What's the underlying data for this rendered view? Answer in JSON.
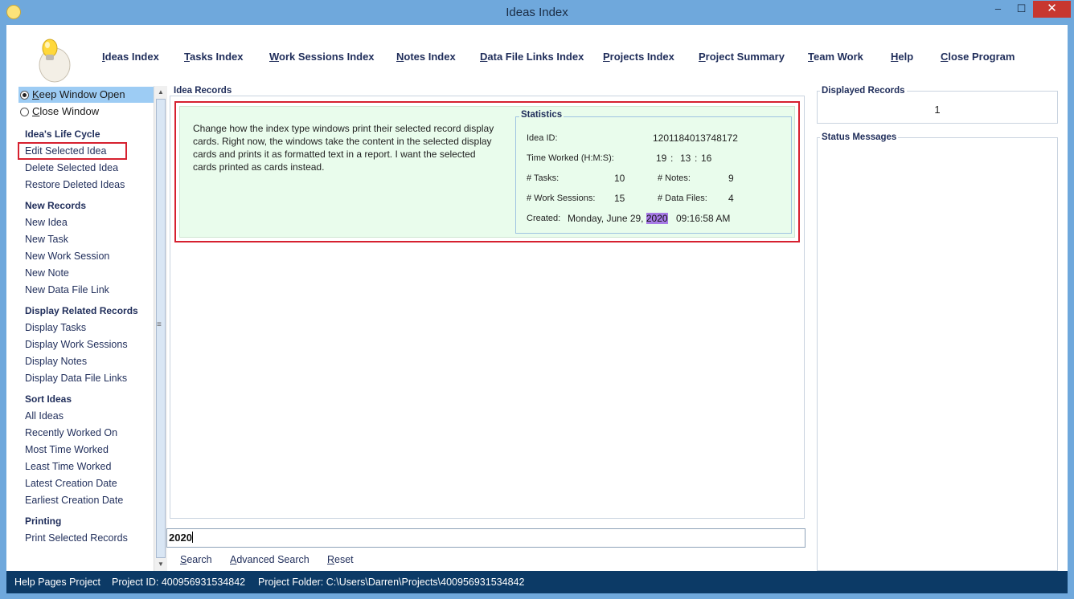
{
  "window": {
    "title": "Ideas Index",
    "min_glyph": "–",
    "max_glyph": "☐",
    "close_glyph": "✕"
  },
  "topnav": {
    "items": [
      {
        "key": "I",
        "rest": "deas Index"
      },
      {
        "key": "T",
        "rest": "asks Index"
      },
      {
        "key": "W",
        "rest": "ork Sessions Index"
      },
      {
        "key": "N",
        "rest": "otes Index"
      },
      {
        "key": "D",
        "rest": "ata File Links Index"
      },
      {
        "key": "P",
        "rest": "rojects Index"
      },
      {
        "key": "P",
        "rest": "roject Summary"
      },
      {
        "key": "T",
        "rest": "eam Work"
      },
      {
        "key": "H",
        "rest": "elp"
      },
      {
        "key": "C",
        "rest": "lose Program"
      }
    ]
  },
  "sidebar": {
    "keep_open_key": "K",
    "keep_open_rest": "eep Window Open",
    "close_window_key": "C",
    "close_window_rest": "lose Window",
    "life_cycle_heading": "Idea's Life Cycle",
    "life_cycle": [
      "Edit Selected Idea",
      "Delete Selected Idea",
      "Restore Deleted Ideas"
    ],
    "new_records_heading": "New Records",
    "new_records": [
      "New Idea",
      "New Task",
      "New Work Session",
      "New Note",
      "New Data File Link"
    ],
    "display_heading": "Display Related Records",
    "display": [
      "Display Tasks",
      "Display Work Sessions",
      "Display Notes",
      "Display Data File Links"
    ],
    "sort_heading": "Sort Ideas",
    "sort": [
      "All Ideas",
      "Recently Worked On",
      "Most Time Worked",
      "Least Time Worked",
      "Latest Creation Date",
      "Earliest Creation Date"
    ],
    "printing_heading": "Printing",
    "printing": [
      "Print Selected Records"
    ]
  },
  "records": {
    "group_title": "Idea Records",
    "card_text": "Change how the index type windows print their selected record display cards. Right now, the windows take the content in the selected display cards and prints it as formatted text in a report. I want the selected cards printed as cards instead.",
    "stats": {
      "title": "Statistics",
      "idea_id_label": "Idea ID:",
      "idea_id": "1201184013748172",
      "time_label": "Time Worked (H:M:S):",
      "hours": "19",
      "minutes": "13",
      "seconds": "16",
      "sep": ":",
      "tasks_label": "# Tasks:",
      "tasks": "10",
      "notes_label": "# Notes:",
      "notes": "9",
      "sessions_label": "# Work Sessions:",
      "sessions": "15",
      "files_label": "# Data Files:",
      "files": "4",
      "created_label": "Created:",
      "created_date_prefix": "Monday, June 29,",
      "created_year": "2020",
      "created_time": "09:16:58 AM"
    }
  },
  "search": {
    "value": "2020",
    "search_key": "S",
    "search_rest": "earch",
    "advanced_key": "A",
    "advanced_rest": "dvanced Search",
    "reset_key": "R",
    "reset_rest": "eset"
  },
  "right": {
    "displayed_title": "Displayed Records",
    "displayed_count": "1",
    "status_title": "Status Messages"
  },
  "statusbar": {
    "project": "Help Pages Project",
    "project_id": "Project ID:  400956931534842",
    "project_folder": "Project Folder: C:\\Users\\Darren\\Projects\\400956931534842"
  }
}
